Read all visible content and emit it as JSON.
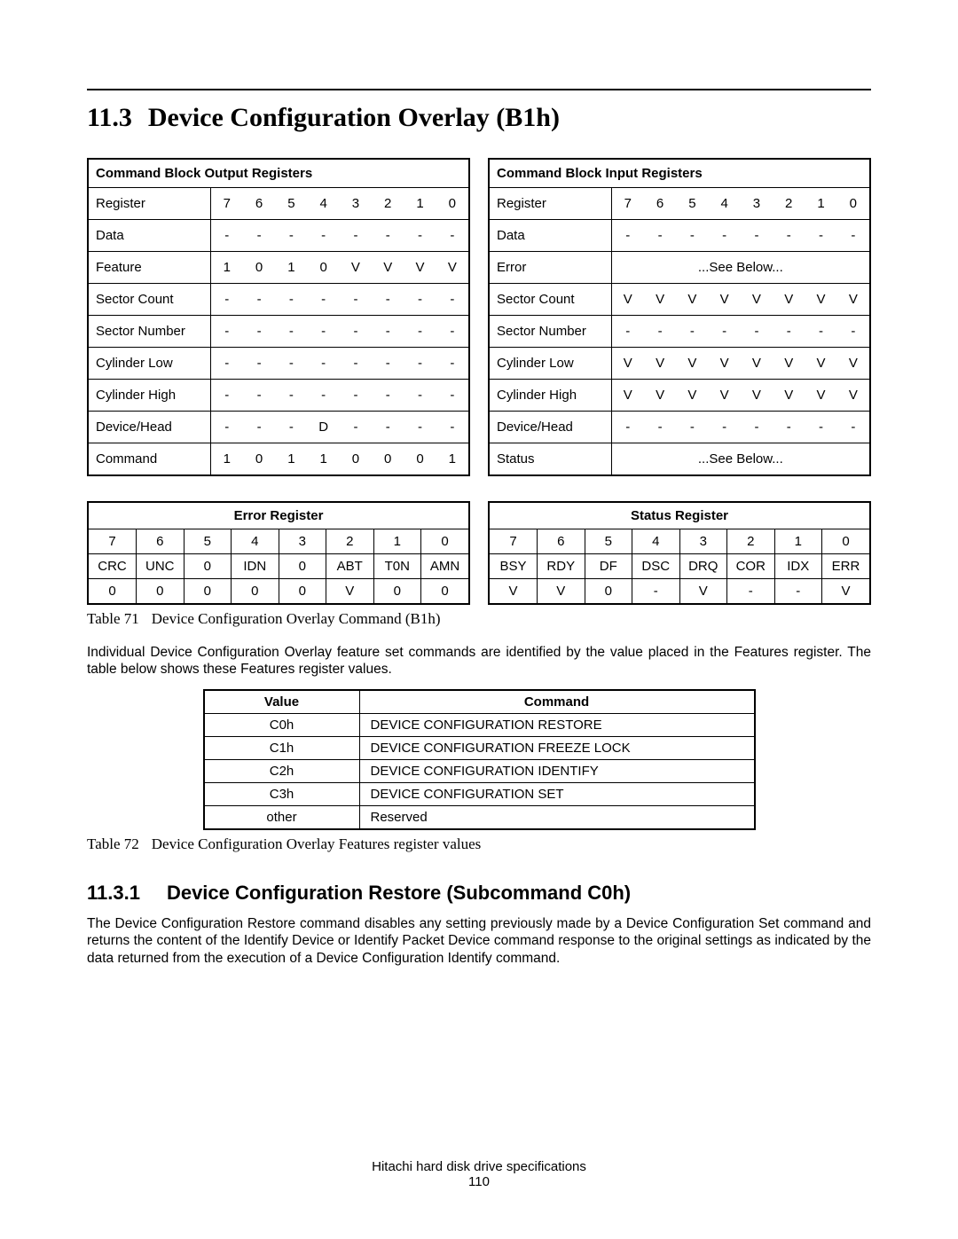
{
  "section": {
    "number": "11.3",
    "title": "Device Configuration Overlay (B1h)"
  },
  "output_registers": {
    "title": "Command Block Output Registers",
    "bit_header": [
      "7",
      "6",
      "5",
      "4",
      "3",
      "2",
      "1",
      "0"
    ],
    "rows": [
      {
        "label": "Register"
      },
      {
        "label": "Data",
        "bits": [
          "-",
          "-",
          "-",
          "-",
          "-",
          "-",
          "-",
          "-"
        ]
      },
      {
        "label": "Feature",
        "bits": [
          "1",
          "0",
          "1",
          "0",
          "V",
          "V",
          "V",
          "V"
        ]
      },
      {
        "label": "Sector Count",
        "bits": [
          "-",
          "-",
          "-",
          "-",
          "-",
          "-",
          "-",
          "-"
        ]
      },
      {
        "label": "Sector Number",
        "bits": [
          "-",
          "-",
          "-",
          "-",
          "-",
          "-",
          "-",
          "-"
        ]
      },
      {
        "label": "Cylinder Low",
        "bits": [
          "-",
          "-",
          "-",
          "-",
          "-",
          "-",
          "-",
          "-"
        ]
      },
      {
        "label": "Cylinder High",
        "bits": [
          "-",
          "-",
          "-",
          "-",
          "-",
          "-",
          "-",
          "-"
        ]
      },
      {
        "label": "Device/Head",
        "bits": [
          "-",
          "-",
          "-",
          "D",
          "-",
          "-",
          "-",
          "-"
        ]
      },
      {
        "label": "Command",
        "bits": [
          "1",
          "0",
          "1",
          "1",
          "0",
          "0",
          "0",
          "1"
        ]
      }
    ]
  },
  "input_registers": {
    "title": "Command Block Input Registers",
    "bit_header": [
      "7",
      "6",
      "5",
      "4",
      "3",
      "2",
      "1",
      "0"
    ],
    "rows": [
      {
        "label": "Register"
      },
      {
        "label": "Data",
        "bits": [
          "-",
          "-",
          "-",
          "-",
          "-",
          "-",
          "-",
          "-"
        ]
      },
      {
        "label": "Error",
        "see": "...See Below..."
      },
      {
        "label": "Sector Count",
        "bits": [
          "V",
          "V",
          "V",
          "V",
          "V",
          "V",
          "V",
          "V"
        ]
      },
      {
        "label": "Sector Number",
        "bits": [
          "-",
          "-",
          "-",
          "-",
          "-",
          "-",
          "-",
          "-"
        ]
      },
      {
        "label": "Cylinder Low",
        "bits": [
          "V",
          "V",
          "V",
          "V",
          "V",
          "V",
          "V",
          "V"
        ]
      },
      {
        "label": "Cylinder High",
        "bits": [
          "V",
          "V",
          "V",
          "V",
          "V",
          "V",
          "V",
          "V"
        ]
      },
      {
        "label": "Device/Head",
        "bits": [
          "-",
          "-",
          "-",
          "-",
          "-",
          "-",
          "-",
          "-"
        ]
      },
      {
        "label": "Status",
        "see": "...See Below..."
      }
    ]
  },
  "error_register": {
    "title": "Error Register",
    "bits": [
      "7",
      "6",
      "5",
      "4",
      "3",
      "2",
      "1",
      "0"
    ],
    "names": [
      "CRC",
      "UNC",
      "0",
      "IDN",
      "0",
      "ABT",
      "T0N",
      "AMN"
    ],
    "values": [
      "0",
      "0",
      "0",
      "0",
      "0",
      "V",
      "0",
      "0"
    ]
  },
  "status_register": {
    "title": "Status Register",
    "bits": [
      "7",
      "6",
      "5",
      "4",
      "3",
      "2",
      "1",
      "0"
    ],
    "names": [
      "BSY",
      "RDY",
      "DF",
      "DSC",
      "DRQ",
      "COR",
      "IDX",
      "ERR"
    ],
    "values": [
      "V",
      "V",
      "0",
      "-",
      "V",
      "-",
      "-",
      "V"
    ]
  },
  "table71_caption": {
    "label": "Table 71",
    "text": "Device Configuration Overlay Command (B1h)"
  },
  "para1": "Individual Device Configuration Overlay feature set commands are identified by the value placed in the Features register. The table below shows these Features register values.",
  "features_table": {
    "headers": [
      "Value",
      "Command"
    ],
    "rows": [
      {
        "value": "C0h",
        "command": "DEVICE CONFIGURATION RESTORE"
      },
      {
        "value": "C1h",
        "command": "DEVICE CONFIGURATION FREEZE LOCK"
      },
      {
        "value": "C2h",
        "command": "DEVICE CONFIGURATION IDENTIFY"
      },
      {
        "value": "C3h",
        "command": "DEVICE CONFIGURATION SET"
      },
      {
        "value": "other",
        "command": "Reserved"
      }
    ]
  },
  "table72_caption": {
    "label": "Table 72",
    "text": "Device Configuration Overlay Features register values"
  },
  "subsection": {
    "number": "11.3.1",
    "title": "Device Configuration Restore (Subcommand C0h)"
  },
  "para2": "The Device Configuration Restore command disables any setting previously made by a Device Configuration Set command and returns the content of the Identify Device or Identify Packet Device command response to the original settings as indicated by the data returned from the execution of a Device Configuration Identify command.",
  "footer": {
    "line1": "Hitachi hard disk drive specifications",
    "line2": "110"
  }
}
